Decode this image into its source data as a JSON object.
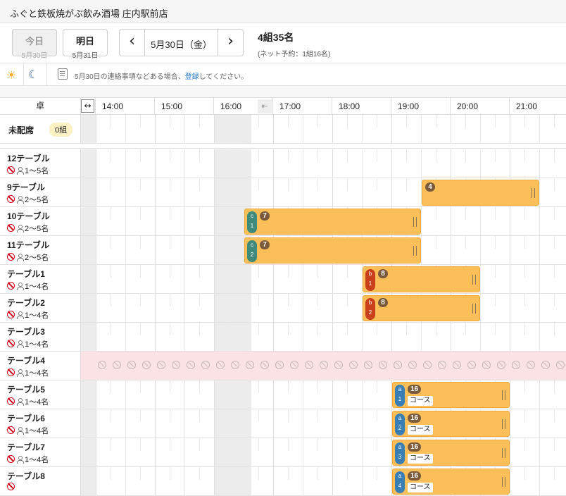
{
  "header": {
    "store_name": "ふぐと鉄板焼がぶ飲み酒場 庄内駅前店"
  },
  "datebar": {
    "today": {
      "label": "今日",
      "date": "5月30日"
    },
    "tomorrow": {
      "label": "明日",
      "date": "5月31日"
    },
    "current_date": "5月30日（金）",
    "prev_icon": "chevron-left-icon",
    "next_icon": "chevron-right-icon",
    "summary_main": "4組35名",
    "summary_sub": "(ネット予約：1組16名)"
  },
  "notebar": {
    "text_before": "5月30日の連絡事項などある場合、",
    "link": "登録",
    "text_after": "してください。"
  },
  "timeline": {
    "table_header": "卓",
    "hours": [
      "14:00",
      "15:00",
      "16:00",
      "17:00",
      "18:00",
      "19:00",
      "20:00",
      "21:00"
    ]
  },
  "unassigned": {
    "label": "未配席",
    "count": "0組"
  },
  "rows": [
    {
      "name": "12テーブル",
      "capacity": "1〜5名"
    },
    {
      "name": "9テーブル",
      "capacity": "2〜5名"
    },
    {
      "name": "10テーブル",
      "capacity": "2〜5名"
    },
    {
      "name": "11テーブル",
      "capacity": "2〜5名"
    },
    {
      "name": "テーブル1",
      "capacity": "1〜4名"
    },
    {
      "name": "テーブル2",
      "capacity": "1〜4名"
    },
    {
      "name": "テーブル3",
      "capacity": "1〜4名"
    },
    {
      "name": "テーブル4",
      "capacity": "1〜4名"
    },
    {
      "name": "テーブル5",
      "capacity": "1〜4名"
    },
    {
      "name": "テーブル6",
      "capacity": "1〜4名"
    },
    {
      "name": "テーブル7",
      "capacity": "1〜4名"
    },
    {
      "name": "テーブル8",
      "capacity": ""
    }
  ],
  "reservations": [
    {
      "row": 1,
      "start": "19:30",
      "end": "21:30",
      "count": "4",
      "tag": "",
      "tag_num": "",
      "course": ""
    },
    {
      "row": 2,
      "start": "16:30",
      "end": "19:30",
      "count": "7",
      "tag": "c",
      "tag_num": "1",
      "course": ""
    },
    {
      "row": 3,
      "start": "16:30",
      "end": "19:30",
      "count": "7",
      "tag": "c",
      "tag_num": "2",
      "course": ""
    },
    {
      "row": 4,
      "start": "18:30",
      "end": "20:30",
      "count": "8",
      "tag": "b",
      "tag_num": "1",
      "course": ""
    },
    {
      "row": 5,
      "start": "18:30",
      "end": "20:30",
      "count": "8",
      "tag": "b",
      "tag_num": "2",
      "course": ""
    },
    {
      "row": 8,
      "start": "19:00",
      "end": "21:00",
      "count": "16",
      "tag": "a",
      "tag_num": "1",
      "course": "コース"
    },
    {
      "row": 9,
      "start": "19:00",
      "end": "21:00",
      "count": "16",
      "tag": "a",
      "tag_num": "2",
      "course": "コース"
    },
    {
      "row": 10,
      "start": "19:00",
      "end": "21:00",
      "count": "16",
      "tag": "a",
      "tag_num": "3",
      "course": "コース"
    },
    {
      "row": 11,
      "start": "19:00",
      "end": "21:00",
      "count": "16",
      "tag": "a",
      "tag_num": "4",
      "course": "コース"
    }
  ],
  "blocked_row": 7,
  "colors": {
    "reservation_fill": "#fbbf5a",
    "tag_c": "#3f8a7a",
    "tag_b": "#c9411c",
    "tag_a": "#3a7fb4",
    "blocked_row_bg": "#fbe3e5",
    "link": "#1a6fc4"
  }
}
